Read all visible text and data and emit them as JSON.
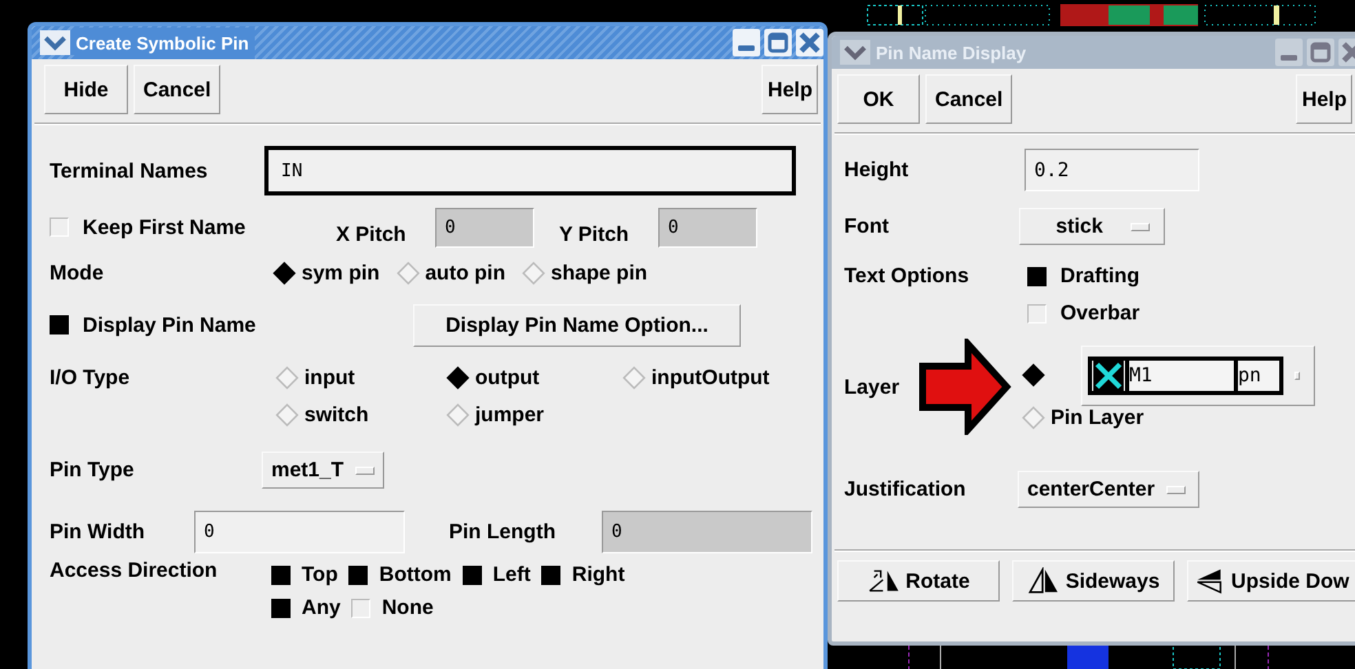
{
  "create_symbolic_pin": {
    "title": "Create Symbolic Pin",
    "active": true,
    "buttons": [
      "Hide",
      "Cancel"
    ],
    "help": "Help",
    "terminal_names": {
      "label": "Terminal Names",
      "value": "IN"
    },
    "keep_first_name": {
      "label": "Keep First Name",
      "checked": false
    },
    "x_pitch": {
      "label": "X Pitch",
      "value": "0",
      "disabled": true
    },
    "y_pitch": {
      "label": "Y Pitch",
      "value": "0",
      "disabled": true
    },
    "mode": {
      "label": "Mode",
      "options": [
        {
          "label": "sym pin",
          "selected": true
        },
        {
          "label": "auto pin",
          "selected": false
        },
        {
          "label": "shape pin",
          "selected": false
        }
      ]
    },
    "display_pin_name": {
      "label": "Display Pin Name",
      "checked": true
    },
    "option_button": "Display Pin Name Option...",
    "io_type": {
      "label": "I/O Type",
      "options": [
        {
          "label": "input",
          "selected": false
        },
        {
          "label": "output",
          "selected": true
        },
        {
          "label": "inputOutput",
          "selected": false
        },
        {
          "label": "switch",
          "selected": false
        },
        {
          "label": "jumper",
          "selected": false
        }
      ]
    },
    "pin_type": {
      "label": "Pin Type",
      "value": "met1_T"
    },
    "pin_width": {
      "label": "Pin Width",
      "value": "0",
      "disabled": false
    },
    "pin_length": {
      "label": "Pin Length",
      "value": "0",
      "disabled": true
    },
    "access_direction": {
      "label": "Access Direction",
      "options": [
        {
          "label": "Top",
          "checked": true
        },
        {
          "label": "Bottom",
          "checked": true
        },
        {
          "label": "Left",
          "checked": true
        },
        {
          "label": "Right",
          "checked": true
        },
        {
          "label": "Any",
          "checked": true
        },
        {
          "label": "None",
          "checked": false
        }
      ]
    }
  },
  "pin_name_display": {
    "title": "Pin Name Display",
    "active": false,
    "buttons": [
      "OK",
      "Cancel"
    ],
    "help": "Help",
    "height": {
      "label": "Height",
      "value": "0.2"
    },
    "font": {
      "label": "Font",
      "value": "stick"
    },
    "text_options": {
      "label": "Text Options",
      "options": [
        {
          "label": "Drafting",
          "checked": true
        },
        {
          "label": "Overbar",
          "checked": false
        }
      ]
    },
    "layer": {
      "label": "Layer",
      "options": [
        {
          "kind": "layer",
          "selected": true,
          "layer": "M1",
          "purpose": "pn"
        },
        {
          "kind": "label",
          "label": "Pin Layer",
          "selected": false
        }
      ]
    },
    "justification": {
      "label": "Justification",
      "value": "centerCenter"
    },
    "transform_buttons": [
      {
        "kind": "rotate",
        "label": "Rotate"
      },
      {
        "kind": "sideways",
        "label": "Sideways"
      },
      {
        "kind": "upside",
        "label": "Upside Dow"
      }
    ]
  }
}
